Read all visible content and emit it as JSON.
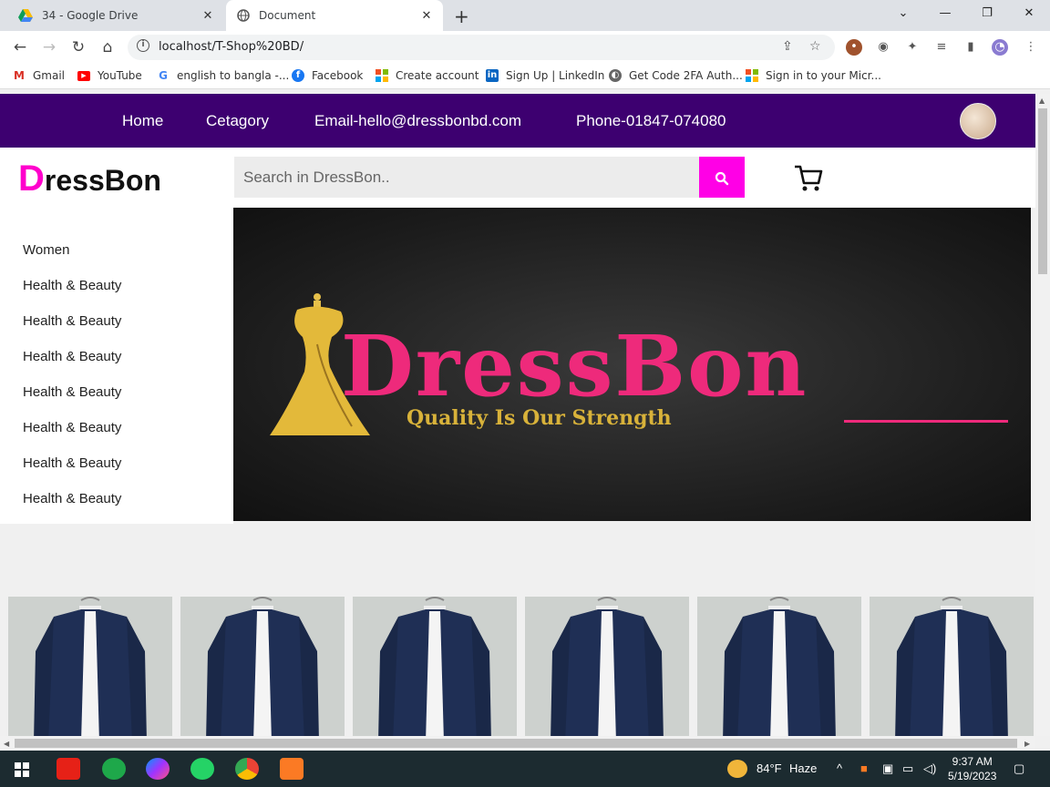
{
  "browser": {
    "tabs": [
      {
        "title": "34 - Google Drive",
        "icon": "google-drive-icon"
      },
      {
        "title": "Document",
        "icon": "globe-icon"
      }
    ],
    "url": "localhost/T-Shop%20BD/",
    "bookmarks": [
      {
        "label": "Gmail",
        "icon": "gmail-icon"
      },
      {
        "label": "YouTube",
        "icon": "youtube-icon"
      },
      {
        "label": "english to bangla -...",
        "icon": "google-icon"
      },
      {
        "label": "Facebook",
        "icon": "facebook-icon"
      },
      {
        "label": "Create account",
        "icon": "microsoft-icon"
      },
      {
        "label": "Sign Up | LinkedIn",
        "icon": "linkedin-icon"
      },
      {
        "label": "Get Code 2FA Auth...",
        "icon": "2fa-icon"
      },
      {
        "label": "Sign in to your Micr...",
        "icon": "microsoft-icon"
      }
    ]
  },
  "site": {
    "nav": [
      "Home",
      "Cetagory",
      "Email-hello@dressbonbd.com",
      "Phone-01847-074080"
    ],
    "logo_first": "D",
    "logo_rest": "ressBon",
    "search_placeholder": "Search in DressBon..",
    "sidebar": [
      "Women",
      "Health & Beauty",
      "Health & Beauty",
      "Health & Beauty",
      "Health & Beauty",
      "Health & Beauty",
      "Health & Beauty",
      "Health & Beauty"
    ],
    "banner": {
      "title": "DressBon",
      "tagline": "Quality Is Our Strength"
    },
    "product_count": 6,
    "colors": {
      "nav_bg": "#3d0070",
      "accent": "#ff00e6",
      "banner_title": "#ee2a7b",
      "banner_tag": "#d8b23a"
    }
  },
  "taskbar": {
    "weather_temp": "84°F",
    "weather_desc": "Haze",
    "time": "9:37 AM",
    "date": "5/19/2023"
  }
}
